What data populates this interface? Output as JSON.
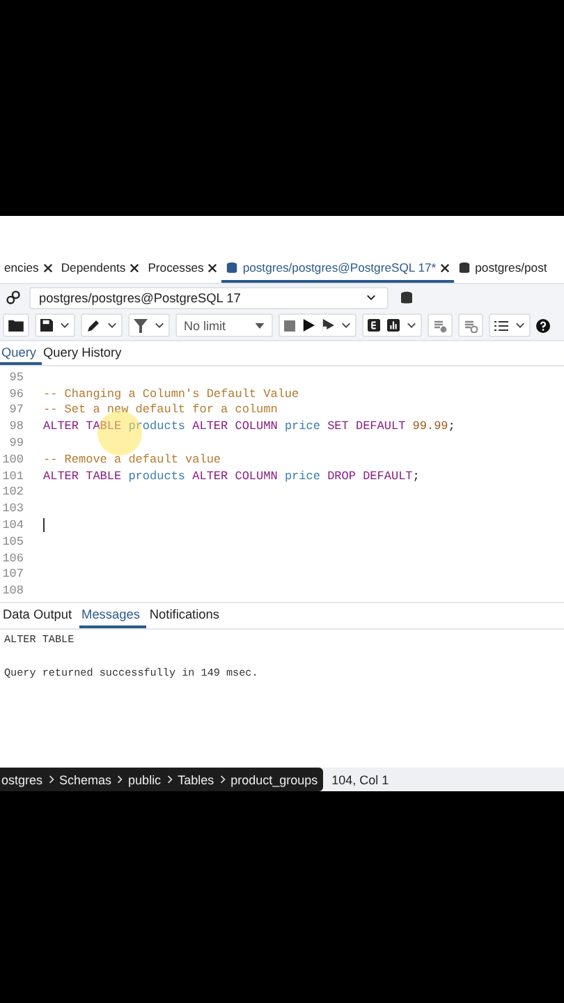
{
  "tabs": [
    {
      "label": "encies",
      "kind": "panel",
      "selected": false
    },
    {
      "label": "Dependents",
      "kind": "panel",
      "selected": false
    },
    {
      "label": "Processes",
      "kind": "panel",
      "selected": false
    },
    {
      "label": "postgres/postgres@PostgreSQL 17*",
      "kind": "query",
      "selected": true
    },
    {
      "label": "postgres/post",
      "kind": "query-cut",
      "selected": false
    }
  ],
  "connection": {
    "label": "postgres/postgres@PostgreSQL 17"
  },
  "toolbar": {
    "limit": "No limit"
  },
  "editor_tabs": [
    {
      "label": "Query",
      "selected": true
    },
    {
      "label": "Query History",
      "selected": false
    }
  ],
  "editor": {
    "lines": [
      {
        "number": "95",
        "cursor": false
      },
      {
        "number": "96",
        "cursor": false,
        "tokens": [
          {
            "kind": "comment",
            "text": "-- Changing a Column's Default Value"
          }
        ]
      },
      {
        "number": "97",
        "cursor": false,
        "tokens": [
          {
            "kind": "comment",
            "text": "-- Set a new default for a column"
          }
        ]
      },
      {
        "number": "98",
        "cursor": false,
        "tokens": [
          {
            "kind": "keyword",
            "text": "ALTER TABLE"
          },
          {
            "kind": "ident",
            "text": " products "
          },
          {
            "kind": "keyword",
            "text": "ALTER COLUMN"
          },
          {
            "kind": "ident",
            "text": " price "
          },
          {
            "kind": "keyword",
            "text": "SET DEFAULT"
          },
          {
            "kind": "number",
            "text": " 99.99"
          },
          {
            "kind": "plain",
            "text": ";"
          }
        ]
      },
      {
        "number": "99",
        "cursor": false
      },
      {
        "number": "100",
        "cursor": false,
        "tokens": [
          {
            "kind": "comment",
            "text": "-- Remove a default value"
          }
        ]
      },
      {
        "number": "101",
        "cursor": false,
        "tokens": [
          {
            "kind": "keyword",
            "text": "ALTER TABLE"
          },
          {
            "kind": "ident",
            "text": " products "
          },
          {
            "kind": "keyword",
            "text": "ALTER COLUMN"
          },
          {
            "kind": "ident",
            "text": " price "
          },
          {
            "kind": "keyword",
            "text": "DROP DEFAULT"
          },
          {
            "kind": "plain",
            "text": ";"
          }
        ]
      },
      {
        "number": "102",
        "cursor": false
      },
      {
        "number": "103",
        "cursor": false
      },
      {
        "number": "104",
        "cursor": true
      },
      {
        "number": "105",
        "cursor": false
      },
      {
        "number": "106",
        "cursor": false
      },
      {
        "number": "107",
        "cursor": false
      },
      {
        "number": "108",
        "cursor": false
      }
    ]
  },
  "output_tabs": [
    {
      "label": "Data Output",
      "selected": false
    },
    {
      "label": "Messages",
      "selected": true
    },
    {
      "label": "Notifications",
      "selected": false
    }
  ],
  "messages": [
    "ALTER TABLE",
    "Query returned successfully in 149 msec."
  ],
  "status_bar": {
    "breadcrumb": [
      "ostgres",
      "Schemas",
      "public",
      "Tables",
      "product_groups"
    ],
    "position": "104, Col 1"
  }
}
